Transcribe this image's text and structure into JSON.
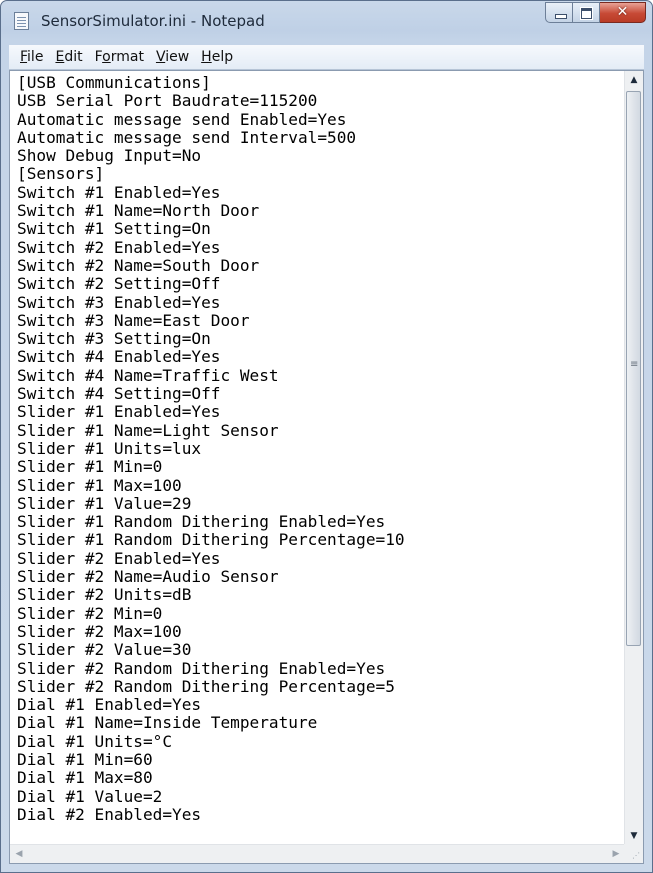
{
  "window": {
    "title": "SensorSimulator.ini - Notepad"
  },
  "caption_buttons": {
    "close_glyph": "✕"
  },
  "menu": [
    {
      "accel": "F",
      "rest": "ile"
    },
    {
      "accel": "E",
      "rest": "dit"
    },
    {
      "pre": "F",
      "accel": "o",
      "rest": "rmat"
    },
    {
      "accel": "V",
      "rest": "iew"
    },
    {
      "accel": "H",
      "rest": "elp"
    }
  ],
  "editor": {
    "content": "[USB Communications]\nUSB Serial Port Baudrate=115200\nAutomatic message send Enabled=Yes\nAutomatic message send Interval=500\nShow Debug Input=No\n[Sensors]\nSwitch #1 Enabled=Yes\nSwitch #1 Name=North Door\nSwitch #1 Setting=On\nSwitch #2 Enabled=Yes\nSwitch #2 Name=South Door\nSwitch #2 Setting=Off\nSwitch #3 Enabled=Yes\nSwitch #3 Name=East Door\nSwitch #3 Setting=On\nSwitch #4 Enabled=Yes\nSwitch #4 Name=Traffic West\nSwitch #4 Setting=Off\nSlider #1 Enabled=Yes\nSlider #1 Name=Light Sensor\nSlider #1 Units=lux\nSlider #1 Min=0\nSlider #1 Max=100\nSlider #1 Value=29\nSlider #1 Random Dithering Enabled=Yes\nSlider #1 Random Dithering Percentage=10\nSlider #2 Enabled=Yes\nSlider #2 Name=Audio Sensor\nSlider #2 Units=dB\nSlider #2 Min=0\nSlider #2 Max=100\nSlider #2 Value=30\nSlider #2 Random Dithering Enabled=Yes\nSlider #2 Random Dithering Percentage=5\nDial #1 Enabled=Yes\nDial #1 Name=Inside Temperature\nDial #1 Units=°C\nDial #1 Min=60\nDial #1 Max=80\nDial #1 Value=2\nDial #2 Enabled=Yes"
  },
  "scrollbar": {
    "up_glyph": "▲",
    "down_glyph": "▼",
    "left_glyph": "◀",
    "right_glyph": "▶",
    "grip_glyph": "≡",
    "size_grip_glyph": "⋰"
  }
}
